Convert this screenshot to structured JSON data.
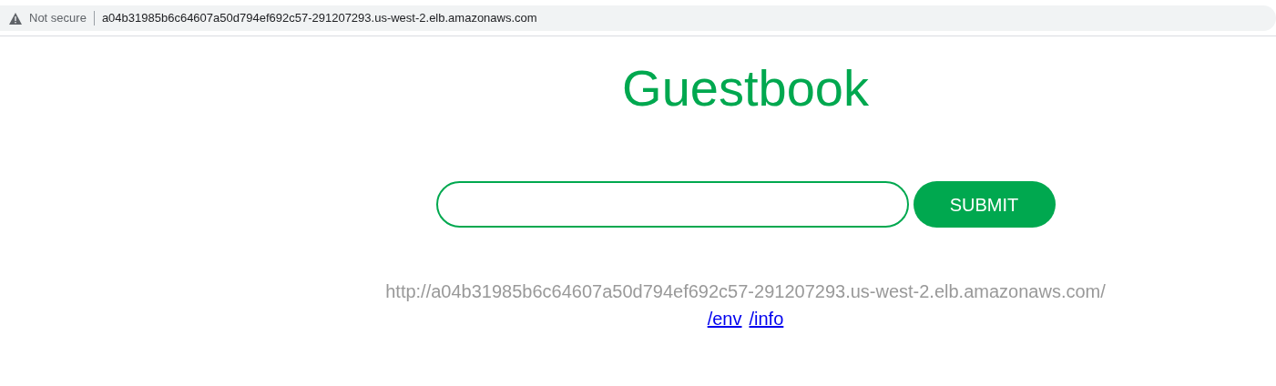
{
  "address_bar": {
    "security": "Not secure",
    "url": "a04b31985b6c64607a50d794ef692c57-291207293.us-west-2.elb.amazonaws.com"
  },
  "title": "Guestbook",
  "form": {
    "button": "SUBMIT"
  },
  "host_url": "http://a04b31985b6c64607a50d794ef692c57-291207293.us-west-2.elb.amazonaws.com/",
  "links": [
    "/env",
    "/info"
  ]
}
